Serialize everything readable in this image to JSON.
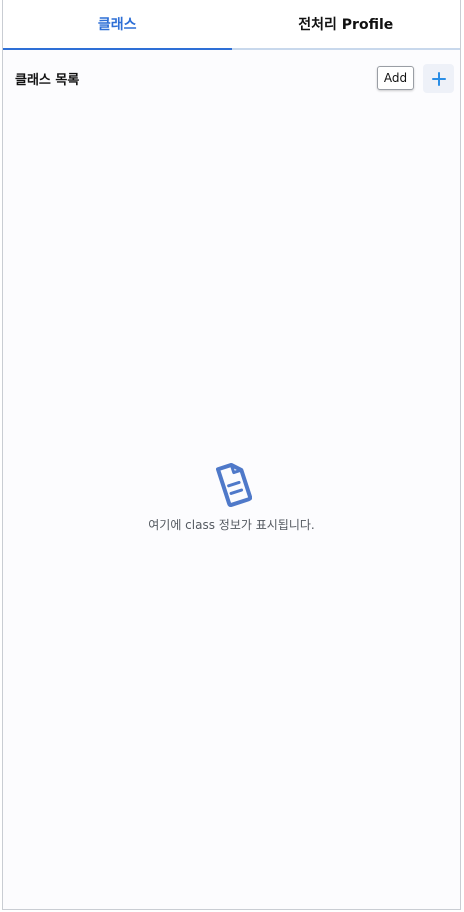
{
  "tabs": [
    {
      "label": "클래스",
      "active": true
    },
    {
      "label": "전처리 Profile",
      "active": false
    }
  ],
  "class_list": {
    "title": "클래스 목록",
    "add_label": "Add",
    "plus_icon": "plus-icon"
  },
  "empty_state": {
    "icon": "document-icon",
    "message": "여기에 class 정보가 표시됩니다."
  },
  "colors": {
    "accent": "#2e6fd6",
    "icon": "#4f79c9"
  }
}
